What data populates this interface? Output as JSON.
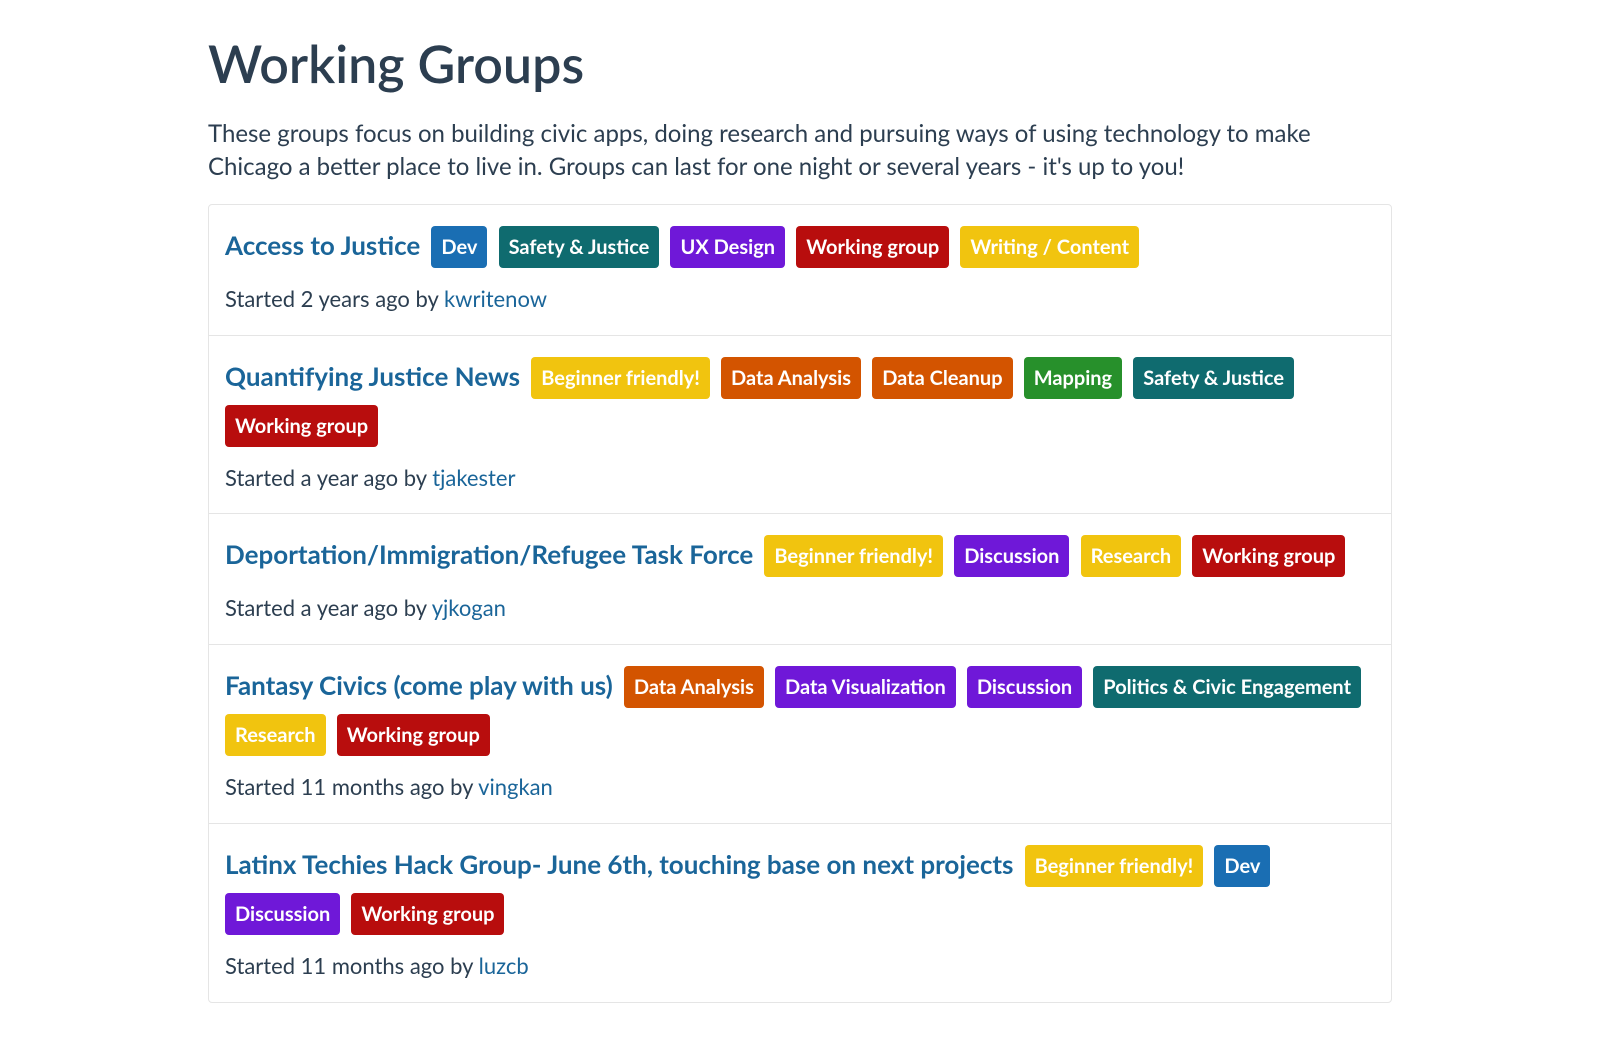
{
  "header": {
    "title": "Working Groups",
    "intro": "These groups focus on building civic apps, doing research and pursuing ways of using technology to make Chicago a better place to live in. Groups can last for one night or several years - it's up to you!"
  },
  "tagColors": {
    "Dev": "#1a6eb3",
    "Safety & Justice": "#0f6b6f",
    "UX Design": "#6f18d8",
    "Working group": "#b80d0d",
    "Writing / Content": "#f1c40f",
    "Beginner friendly!": "#f1c40f",
    "Data Analysis": "#d35400",
    "Data Cleanup": "#d35400",
    "Mapping": "#27902b",
    "Discussion": "#6f18d8",
    "Research": "#f1c40f",
    "Data Visualization": "#6f18d8",
    "Politics & Civic Engagement": "#0f6b6f"
  },
  "groups": [
    {
      "title": "Access to Justice",
      "tags": [
        "Dev",
        "Safety & Justice",
        "UX Design",
        "Working group",
        "Writing / Content"
      ],
      "started_prefix": "Started ",
      "started_time": "2 years ago",
      "by_text": " by ",
      "author": "kwritenow"
    },
    {
      "title": "Quantifying Justice News",
      "tags": [
        "Beginner friendly!",
        "Data Analysis",
        "Data Cleanup",
        "Mapping",
        "Safety & Justice",
        "Working group"
      ],
      "started_prefix": "Started ",
      "started_time": "a year ago",
      "by_text": " by ",
      "author": "tjakester"
    },
    {
      "title": "Deportation/Immigration/Refugee Task Force",
      "tags": [
        "Beginner friendly!",
        "Discussion",
        "Research",
        "Working group"
      ],
      "started_prefix": "Started ",
      "started_time": "a year ago",
      "by_text": " by ",
      "author": "yjkogan"
    },
    {
      "title": "Fantasy Civics (come play with us)",
      "tags": [
        "Data Analysis",
        "Data Visualization",
        "Discussion",
        "Politics & Civic Engagement",
        "Research",
        "Working group"
      ],
      "started_prefix": "Started ",
      "started_time": "11 months ago",
      "by_text": " by ",
      "author": "vingkan"
    },
    {
      "title": "Latinx Techies Hack Group- June 6th, touching base on next projects",
      "tags": [
        "Beginner friendly!",
        "Dev",
        "Discussion",
        "Working group"
      ],
      "started_prefix": "Started ",
      "started_time": "11 months ago",
      "by_text": " by ",
      "author": "luzcb"
    }
  ]
}
